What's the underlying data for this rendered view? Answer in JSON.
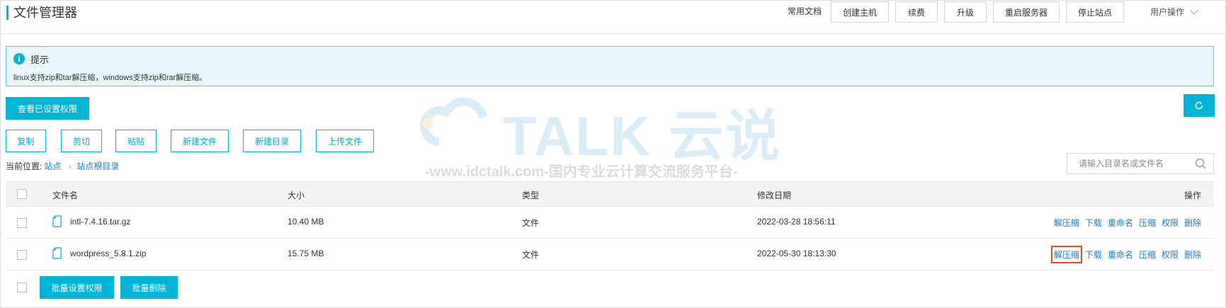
{
  "header": {
    "title": "文件管理器",
    "common_docs": "常用文档",
    "buttons": [
      "创建主机",
      "续费",
      "升级",
      "重启服务器",
      "停止站点"
    ],
    "user_ops": "用户操作"
  },
  "notice": {
    "title": "提示",
    "text": "linux支持zip和tar解压缩，windows支持zip和rar解压缩。"
  },
  "view_permissions_label": "查看已设置权限",
  "toolbar": [
    "复制",
    "剪切",
    "粘贴",
    "新建文件",
    "新建目录",
    "上传文件"
  ],
  "breadcrumb": {
    "prefix": "当前位置:",
    "items": [
      "站点",
      "站点根目录"
    ]
  },
  "search": {
    "placeholder": "请输入目录名或文件名"
  },
  "table": {
    "headers": {
      "name": "文件名",
      "size": "大小",
      "type": "类型",
      "modified": "修改日期",
      "actions": "操作"
    },
    "action_labels": [
      "解压缩",
      "下载",
      "重命名",
      "压缩",
      "权限",
      "删除"
    ],
    "rows": [
      {
        "name": "intl-7.4.16.tar.gz",
        "size": "10.40 MB",
        "type": "文件",
        "modified": "2022-03-28 18:56:11"
      },
      {
        "name": "wordpress_5.8.1.zip",
        "size": "15.75 MB",
        "type": "文件",
        "modified": "2022-05-30 18:13:30"
      }
    ]
  },
  "batch": {
    "set_permissions": "批量设置权限",
    "delete": "批量删除"
  },
  "watermark": {
    "brand": "TALK 云说",
    "subtitle": "-www.idctalk.com-国内专业云计算交流服务平台-"
  },
  "colors": {
    "accent": "#00b5d8",
    "link": "#1a7dd1",
    "highlight": "#e8491d"
  }
}
